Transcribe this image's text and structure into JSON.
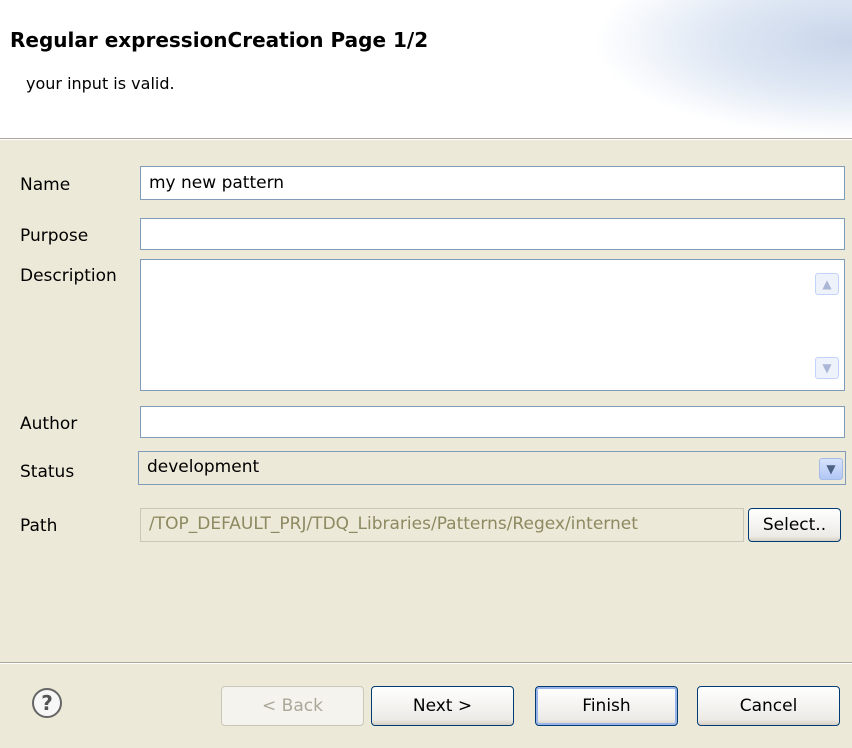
{
  "header": {
    "title": "Regular expressionCreation Page 1/2",
    "message": "your input is valid."
  },
  "form": {
    "name": {
      "label": "Name",
      "value": "my new pattern"
    },
    "purpose": {
      "label": "Purpose",
      "value": ""
    },
    "description": {
      "label": "Description",
      "value": ""
    },
    "author": {
      "label": "Author",
      "value": ""
    },
    "status": {
      "label": "Status",
      "value": "development"
    },
    "path": {
      "label": "Path",
      "value": "/TOP_DEFAULT_PRJ/TDQ_Libraries/Patterns/Regex/internet",
      "select_label": "Select.."
    }
  },
  "icons": {
    "help": "help-icon",
    "scroll_up": "scroll-up-arrow-icon",
    "scroll_down": "scroll-down-arrow-icon",
    "dropdown": "chevron-down-icon"
  },
  "footer": {
    "help_glyph": "?",
    "back_label": "< Back",
    "next_label": "Next >",
    "finish_label": "Finish",
    "cancel_label": "Cancel"
  },
  "colors": {
    "dialog_bg": "#ece9d8",
    "field_border": "#7f9db9",
    "button_border": "#003c74",
    "disabled_text": "#aca899",
    "path_text": "#8d8961"
  }
}
